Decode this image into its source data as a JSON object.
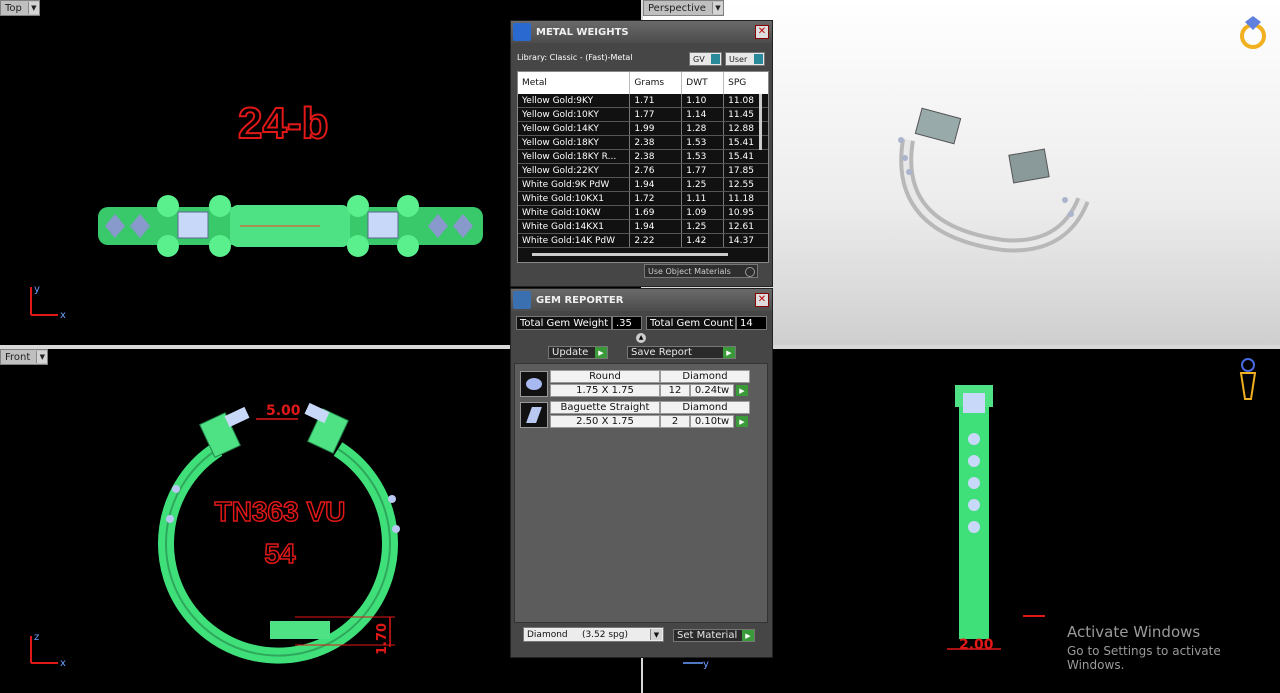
{
  "viewports": {
    "top": {
      "label": "Top",
      "engraving": "24-b",
      "axis_v": "y",
      "axis_h": "x"
    },
    "perspective": {
      "label": "Perspective"
    },
    "front": {
      "label": "Front",
      "engraving_line1": "TN363 VU",
      "engraving_line2": "54",
      "dim_gap": "5.00",
      "dim_height": "1.70",
      "axis_v": "z",
      "axis_h": "x"
    },
    "right": {
      "dim_width": "2.00",
      "axis_h": "y"
    }
  },
  "metal_weights": {
    "title": "METAL WEIGHTS",
    "library": "Library: Classic - (Fast)-Metal",
    "gv_label": "GV",
    "user_label": "User",
    "columns": [
      "Metal",
      "Grams",
      "DWT",
      "SPG"
    ],
    "rows": [
      {
        "metal": "Yellow Gold:9KY",
        "grams": "1.71",
        "dwt": "1.10",
        "spg": "11.08"
      },
      {
        "metal": "Yellow Gold:10KY",
        "grams": "1.77",
        "dwt": "1.14",
        "spg": "11.45"
      },
      {
        "metal": "Yellow Gold:14KY",
        "grams": "1.99",
        "dwt": "1.28",
        "spg": "12.88"
      },
      {
        "metal": "Yellow Gold:18KY",
        "grams": "2.38",
        "dwt": "1.53",
        "spg": "15.41"
      },
      {
        "metal": "Yellow Gold:18KY R...",
        "grams": "2.38",
        "dwt": "1.53",
        "spg": "15.41"
      },
      {
        "metal": "Yellow Gold:22KY",
        "grams": "2.76",
        "dwt": "1.77",
        "spg": "17.85"
      },
      {
        "metal": "White Gold:9K PdW",
        "grams": "1.94",
        "dwt": "1.25",
        "spg": "12.55"
      },
      {
        "metal": "White Gold:10KX1",
        "grams": "1.72",
        "dwt": "1.11",
        "spg": "11.18"
      },
      {
        "metal": "White Gold:10KW",
        "grams": "1.69",
        "dwt": "1.09",
        "spg": "10.95"
      },
      {
        "metal": "White Gold:14KX1",
        "grams": "1.94",
        "dwt": "1.25",
        "spg": "12.61"
      },
      {
        "metal": "White Gold:14K PdW",
        "grams": "2.22",
        "dwt": "1.42",
        "spg": "14.37"
      }
    ],
    "use_object_materials": "Use Object Materials"
  },
  "gem_reporter": {
    "title": "GEM REPORTER",
    "total_weight_label": "Total Gem Weight",
    "total_weight_value": ".35",
    "total_count_label": "Total Gem Count",
    "total_count_value": "14",
    "update_label": "Update",
    "save_report_label": "Save Report",
    "gems": [
      {
        "icon": "round-gem-icon",
        "cut": "Round",
        "material": "Diamond",
        "size": "1.75 X 1.75",
        "count": "12",
        "weight": "0.24tw"
      },
      {
        "icon": "baguette-gem-icon",
        "cut": "Baguette Straight",
        "material": "Diamond",
        "size": "2.50 X 1.75",
        "count": "2",
        "weight": "0.10tw"
      }
    ],
    "material_select": "Diamond     (3.52 spg)",
    "set_material_label": "Set Material"
  },
  "watermark": {
    "line1": "Activate Windows",
    "line2": "Go to Settings to activate Windows."
  },
  "colors": {
    "ring_green": "#3fe07a",
    "dim_red": "#e01818",
    "panel_gray": "#464646"
  }
}
